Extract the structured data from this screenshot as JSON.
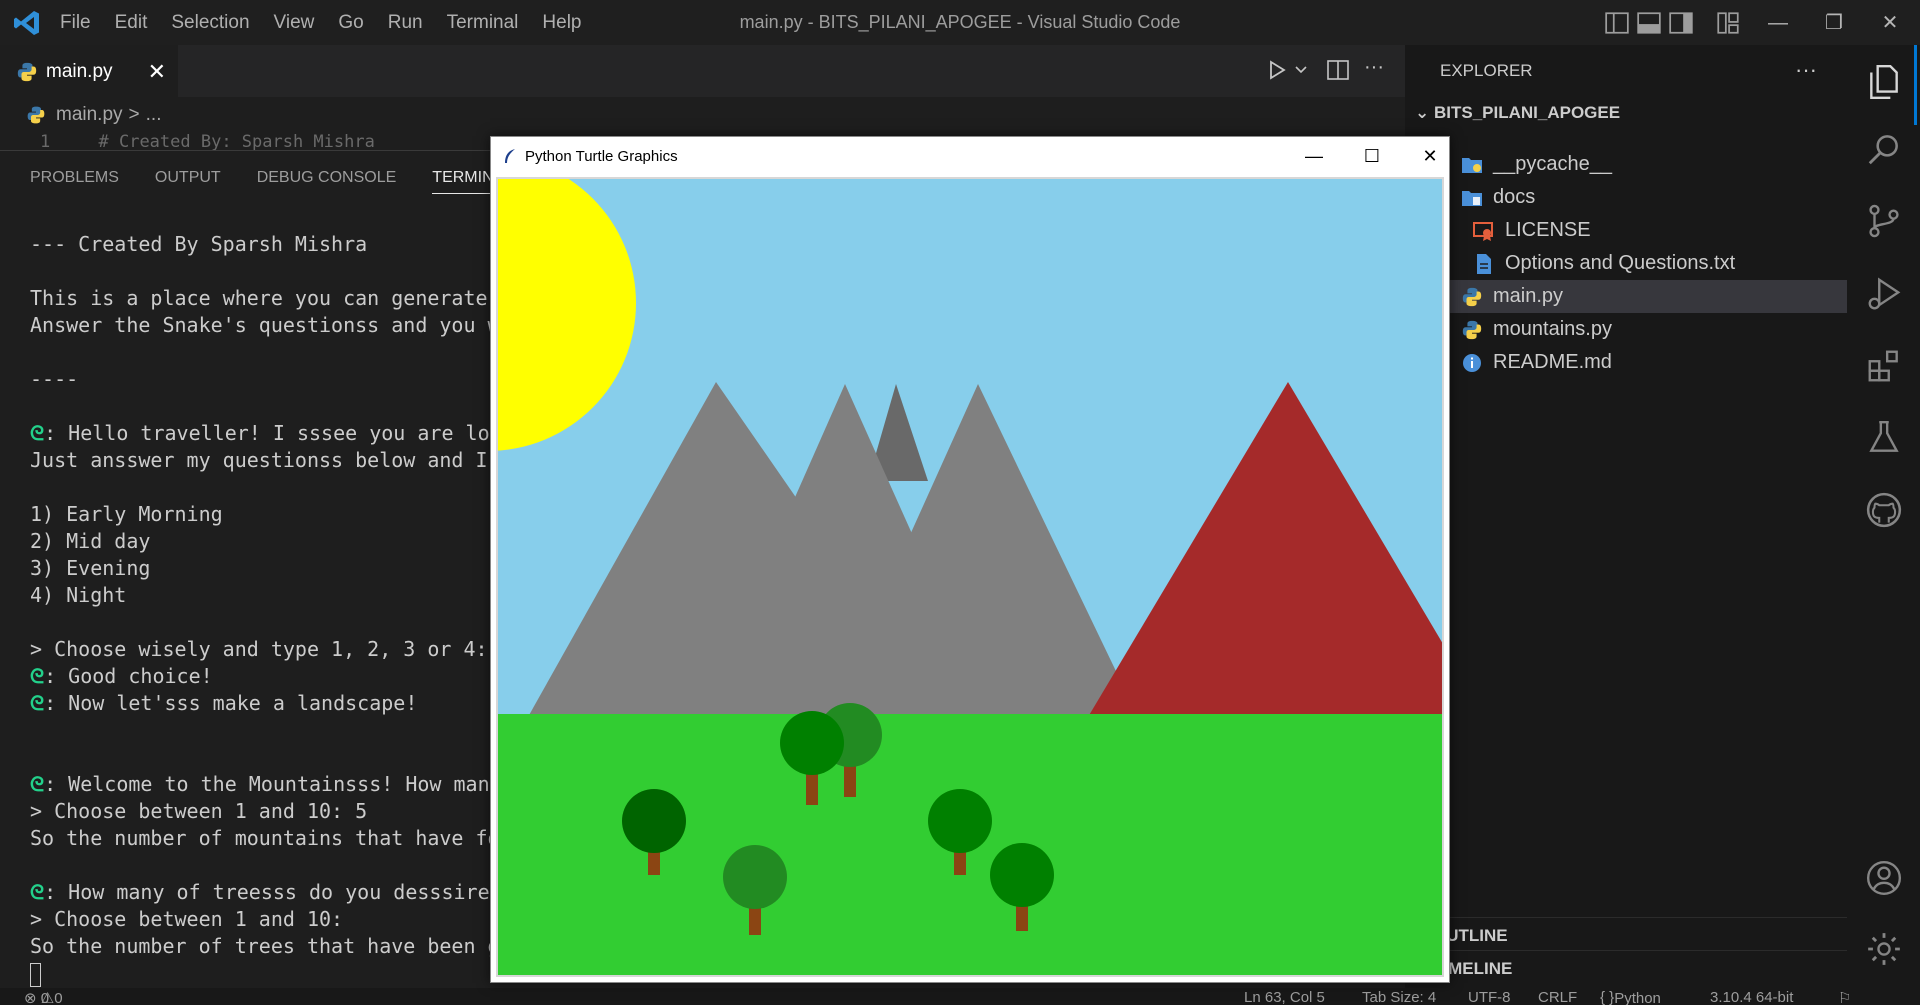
{
  "titlebar": {
    "menu": [
      "File",
      "Edit",
      "Selection",
      "View",
      "Go",
      "Run",
      "Terminal",
      "Help"
    ],
    "window_title": "main.py - BITS_PILANI_APOGEE - Visual Studio Code"
  },
  "tabs": {
    "active_label": "main.py",
    "close_glyph": "✕"
  },
  "breadcrumb": {
    "file": "main.py",
    "sep": ">",
    "rest": "..."
  },
  "editor": {
    "line_no": "1",
    "line_text": "# Created By: Sparsh Mishra"
  },
  "panel": {
    "tabs": [
      "PROBLEMS",
      "OUTPUT",
      "DEBUG CONSOLE",
      "TERMINAL"
    ],
    "terminal": {
      "l1": "--- Created By Sparsh Mishra",
      "l2": "This is a place where you can generate",
      "l3": "Answer the Snake's questionss and you w",
      "l4": "----",
      "l5": ": Hello traveller! I sssee you are lo",
      "l6": "Just ansswer my questionss below and I",
      "l7": "1) Early Morning",
      "l8": "2) Mid day",
      "l9": "3) Evening",
      "l10": "4) Night",
      "l11": "> Choose wisely and type 1, 2, 3 or 4:",
      "l12": ": Good choice!",
      "l13": ": Now let'sss make a landscape!",
      "l14": ": Welcome to the Mountainsss! How man",
      "l15": "> Choose between 1 and 10: 5",
      "l16": "So the number of mountains that have fo",
      "l17": ": How many of treesss do you desssire",
      "l18": "> Choose between 1 and 10:",
      "l19": "So the number of trees that have been g"
    }
  },
  "explorer": {
    "header": "EXPLORER",
    "more": "···",
    "root": "BITS_PILANI_APOGEE",
    "items": [
      {
        "label": "__pycache__",
        "icon": "folder-icon"
      },
      {
        "label": "docs",
        "icon": "folder-icon"
      },
      {
        "label": "LICENSE",
        "icon": "license-icon"
      },
      {
        "label": "Options and Questions.txt",
        "icon": "text-file-icon"
      },
      {
        "label": "main.py",
        "icon": "python-icon"
      },
      {
        "label": "mountains.py",
        "icon": "python-icon"
      },
      {
        "label": "README.md",
        "icon": "info-icon"
      }
    ],
    "outline": "OUTLINE",
    "timeline": "TIMELINE"
  },
  "statusbar": {
    "problems": "0",
    "warnings": "0",
    "position": "Ln 63, Col 5",
    "tab_size": "Tab Size: 4",
    "encoding": "UTF-8",
    "eol": "CRLF",
    "language": "Python",
    "interpreter": "3.10.4 64-bit"
  },
  "turtle_window": {
    "title": "Python Turtle Graphics",
    "colors": {
      "sky": "#87CEEB",
      "sun": "#FFFF00",
      "grass": "#32CD32",
      "mountain_gray": "#808080",
      "mountain_dark": "#696969",
      "mountain_red": "#A52A2A",
      "trunk": "#8B4513",
      "tree_green": "#008000",
      "tree_dark": "#006400",
      "tree_forest": "#228B22"
    }
  }
}
